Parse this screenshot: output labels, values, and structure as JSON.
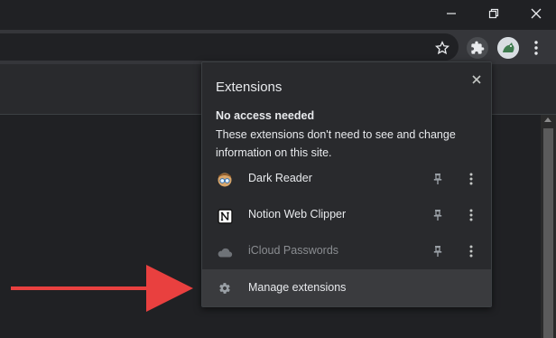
{
  "window": {
    "controls": [
      "minimize-icon",
      "restore-icon",
      "close-icon"
    ]
  },
  "toolbar": {
    "icons": [
      "star-icon",
      "puzzle-icon",
      "avatar",
      "kebab-menu-icon"
    ]
  },
  "popup": {
    "title": "Extensions",
    "close_icon": "close-icon",
    "section_title": "No access needed",
    "section_desc": "These extensions don't need to see and change information on this site.",
    "extensions": [
      {
        "name": "Dark Reader",
        "icon": "dark-reader-icon",
        "pinned": false
      },
      {
        "name": "Notion Web Clipper",
        "icon": "notion-icon",
        "pinned": false
      },
      {
        "name": "iCloud Passwords",
        "icon": "icloud-icon",
        "pinned": false,
        "disabled": true
      }
    ],
    "manage_label": "Manage extensions",
    "manage_icon": "gear-icon"
  },
  "annotation": {
    "arrow_color": "#e9403f"
  },
  "colors": {
    "background": "#202124",
    "toolbar": "#35363a",
    "popup": "#292a2d",
    "hover_row": "#3a3b3e"
  }
}
